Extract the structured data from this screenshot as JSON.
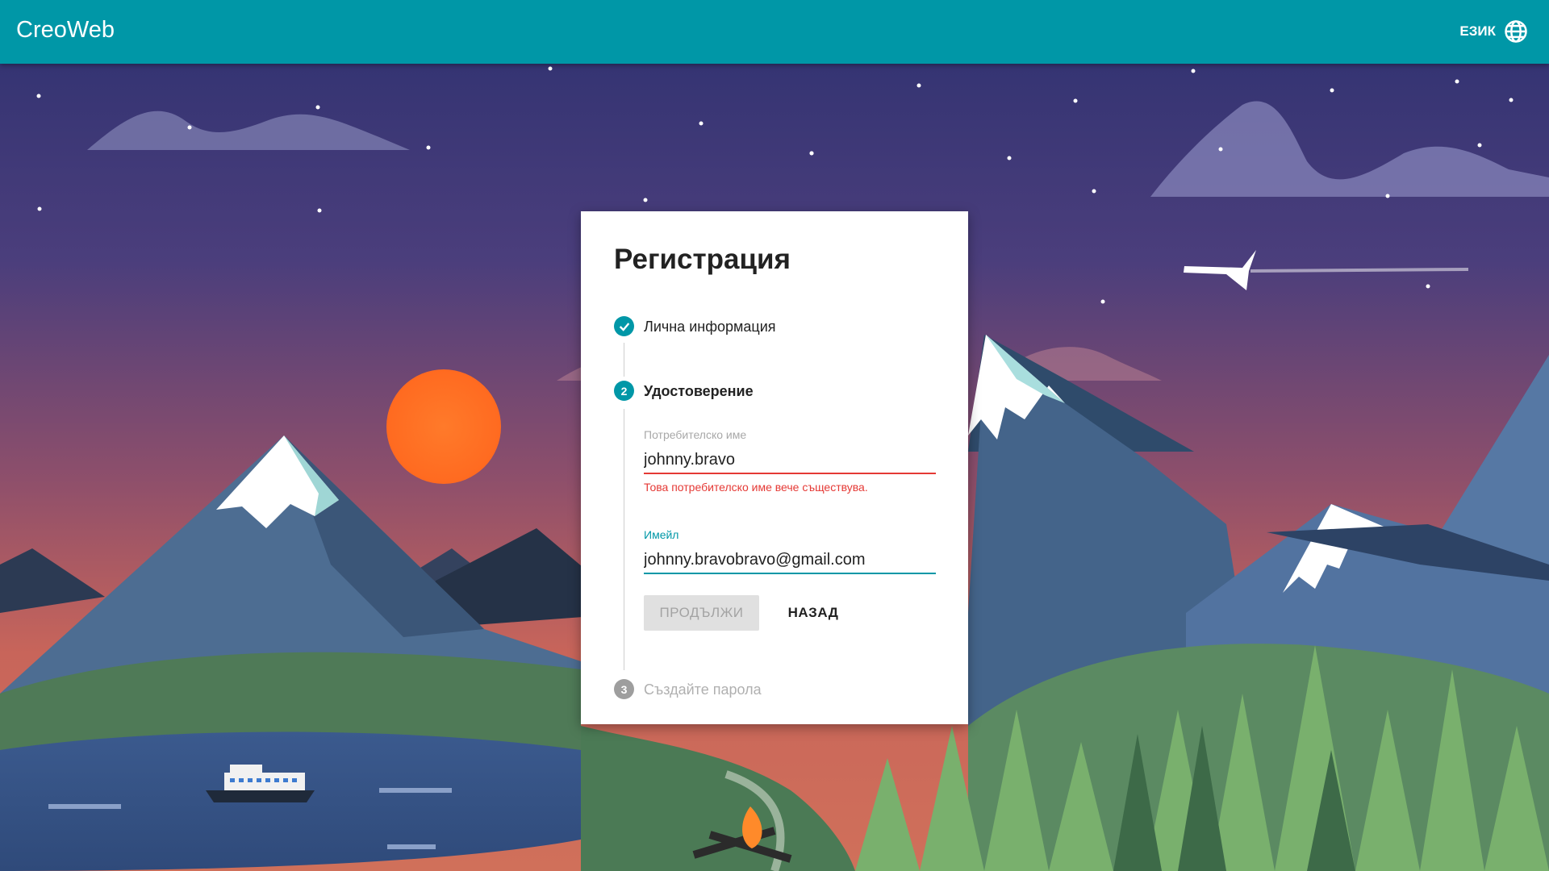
{
  "header": {
    "brand": "CreoWeb",
    "language_label": "ЕЗИК",
    "accent_color": "#0097a7"
  },
  "card": {
    "title": "Регистрация",
    "steps": [
      {
        "number": "1",
        "label": "Лична информация",
        "state": "completed",
        "icon": "check-icon"
      },
      {
        "number": "2",
        "label": "Удостоверение",
        "state": "active"
      },
      {
        "number": "3",
        "label": "Създайте парола",
        "state": "pending"
      }
    ],
    "username": {
      "label": "Потребителско име",
      "value": "johnny.bravo",
      "error": "Това потребителско име вече съществува."
    },
    "email": {
      "label": "Имейл",
      "value": "johnny.bravobravo@gmail.com"
    },
    "buttons": {
      "continue": "ПРОДЪЛЖИ",
      "back": "НАЗАД"
    }
  },
  "colors": {
    "error": "#e53935",
    "disabled_button": "#e0e0e0",
    "header": "#0097a7"
  }
}
